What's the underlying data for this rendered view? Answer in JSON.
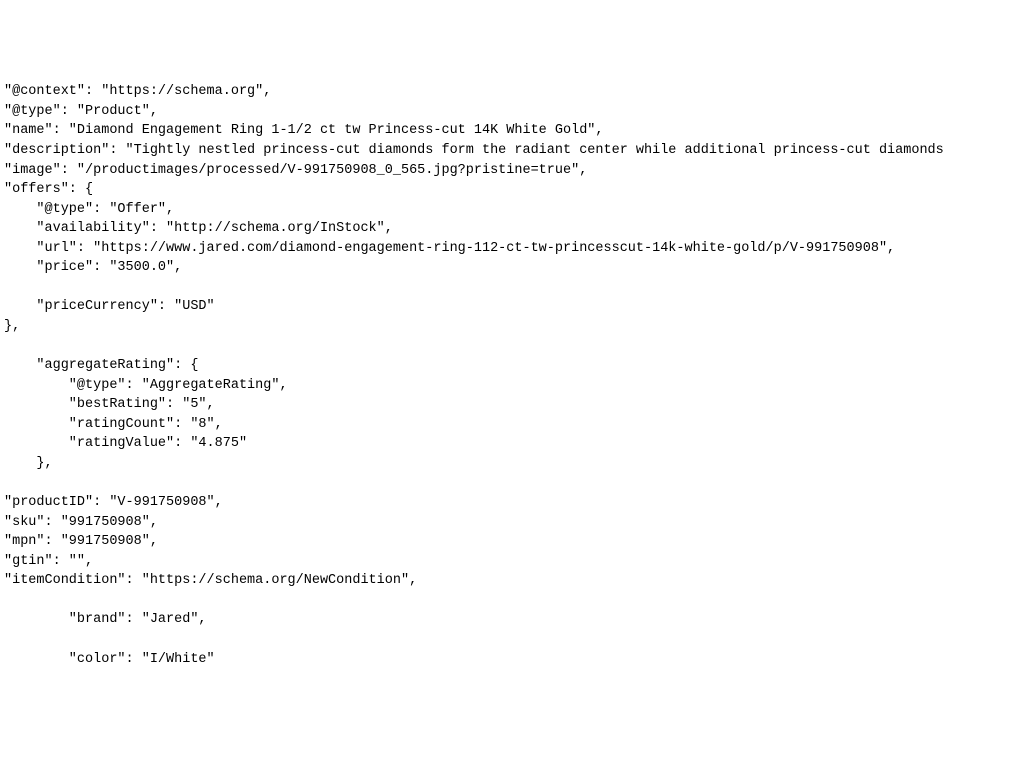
{
  "lines": [
    "\"@context\": \"https://schema.org\",",
    "\"@type\": \"Product\",",
    "\"name\": \"Diamond Engagement Ring 1-1/2 ct tw Princess-cut 14K White Gold\",",
    "\"description\": \"Tightly nestled princess-cut diamonds form the radiant center while additional princess-cut diamonds",
    "\"image\": \"/productimages/processed/V-991750908_0_565.jpg?pristine=true\",",
    "\"offers\": {",
    "    \"@type\": \"Offer\",",
    "    \"availability\": \"http://schema.org/InStock\",",
    "    \"url\": \"https://www.jared.com/diamond-engagement-ring-112-ct-tw-princesscut-14k-white-gold/p/V-991750908\",",
    "    \"price\": \"3500.0\",",
    "",
    "    \"priceCurrency\": \"USD\"",
    "},",
    "",
    "    \"aggregateRating\": {",
    "        \"@type\": \"AggregateRating\",",
    "        \"bestRating\": \"5\",",
    "        \"ratingCount\": \"8\",",
    "        \"ratingValue\": \"4.875\"",
    "    },",
    "",
    "\"productID\": \"V-991750908\",",
    "\"sku\": \"991750908\",",
    "\"mpn\": \"991750908\",",
    "\"gtin\": \"\",",
    "\"itemCondition\": \"https://schema.org/NewCondition\",",
    "",
    "        \"brand\": \"Jared\",",
    "",
    "        \"color\": \"I/White\""
  ]
}
